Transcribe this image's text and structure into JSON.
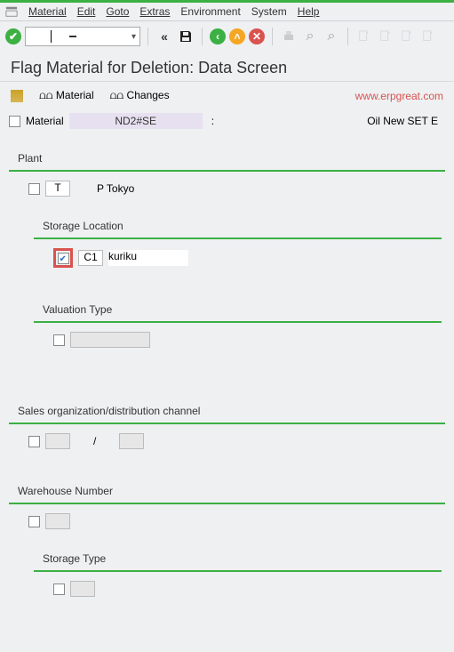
{
  "menu": {
    "items": [
      "Material",
      "Edit",
      "Goto",
      "Extras",
      "Environment",
      "System",
      "Help"
    ]
  },
  "toolbar": {
    "back_label": "«",
    "cmd_value": "",
    "cmd_cursor": "I"
  },
  "title": "Flag Material for Deletion: Data Screen",
  "subtoolbar": {
    "material_link": "⩍⩍ Material",
    "changes_link": "⩍⩍ Changes"
  },
  "watermark": "www.erpgreat.com",
  "material": {
    "label": "Material",
    "value": "ND2#SE",
    "colon": ":",
    "desc": "Oil New SET E"
  },
  "plant": {
    "title": "Plant",
    "code": "T",
    "name": "P Tokyo",
    "storage_location": {
      "title": "Storage Location",
      "code": "C1",
      "name": "kuriku"
    },
    "valuation_type": {
      "title": "Valuation Type"
    }
  },
  "sales": {
    "title": "Sales organization/distribution channel",
    "slash": "/"
  },
  "warehouse": {
    "title": "Warehouse Number",
    "storage_type": {
      "title": "Storage Type"
    }
  }
}
